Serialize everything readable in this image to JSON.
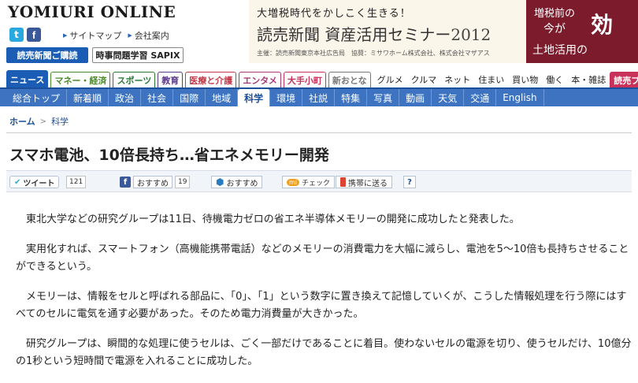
{
  "header": {
    "logo": "YOMIURI ONLINE",
    "links": [
      "サイトマップ",
      "会社案内"
    ],
    "btn_shinbun": "読売新聞ご購読",
    "btn_sapix": "時事問題学習 SAPIX"
  },
  "ad": {
    "top": "大増税時代をかしこく生きる！",
    "main": "読売新聞 資産活用セミナー",
    "year": "2012",
    "small": "主催：読売新聞東京本社広告局　協賛：ミサワホーム株式会社、株式会社マザアス",
    "right_line1": "増税前の",
    "right_line2": "今が",
    "right_big": "効",
    "right_line3": "土地活用の"
  },
  "categories": [
    {
      "label": "ニュース",
      "color": "#1b5db4",
      "active": true
    },
    {
      "label": "マネー・経済",
      "color": "#4a8a2a"
    },
    {
      "label": "スポーツ",
      "color": "#2a7b3a"
    },
    {
      "label": "教育",
      "color": "#5a3a8a"
    },
    {
      "label": "医療と介護",
      "color": "#c43a4a"
    },
    {
      "label": "エンタメ",
      "color": "#a83a7a"
    },
    {
      "label": "大手小町",
      "color": "#c8315a"
    },
    {
      "label": "新おとな",
      "color": "#777"
    }
  ],
  "categories_plain": [
    "グルメ",
    "クルマ",
    "ネット",
    "住まい",
    "買い物",
    "働く",
    "本・雑誌"
  ],
  "categories_last": "読売プレ",
  "subnav": [
    "総合トップ",
    "新着順",
    "政治",
    "社会",
    "国際",
    "地域",
    "科学",
    "環境",
    "社説",
    "特集",
    "写真",
    "動画",
    "天気",
    "交通",
    "English"
  ],
  "subnav_active": "科学",
  "breadcrumb": {
    "home": "ホーム",
    "sep": ">",
    "current": "科学"
  },
  "article": {
    "title": "スマホ電池、10倍長持ち…省エネメモリー開発",
    "paragraphs": [
      "東北大学などの研究グループは11日、待機電力ゼロの省エネ半導体メモリーの開発に成功したと発表した。",
      "実用化すれば、スマートフォン（高機能携帯電話）などのメモリーの消費電力を大幅に減らし、電池を5～10倍も長持ちさせることができるという。",
      "メモリーは、情報をセルと呼ばれる部品に、「0」、「1」という数字に置き換えて記憶していくが、こうした情報処理を行う際にはすべてのセルに電気を通す必要があった。そのため電力消費量が大きかった。",
      "研究グループは、瞬間的な処理に使うセルは、ごく一部だけであることに着目。使わないセルの電源を切り、使うセルだけ、10億分の1秒という短時間で電源を入れることに成功した。"
    ]
  },
  "share": {
    "tweet": "ツイート",
    "tweet_count": "121",
    "fb_label": "おすすめ",
    "fb_count": "19",
    "hx_label": "おすすめ",
    "mx_badge": "mi",
    "mx_label": "チェック",
    "mobile_label": "携帯に送る",
    "help": "?"
  }
}
